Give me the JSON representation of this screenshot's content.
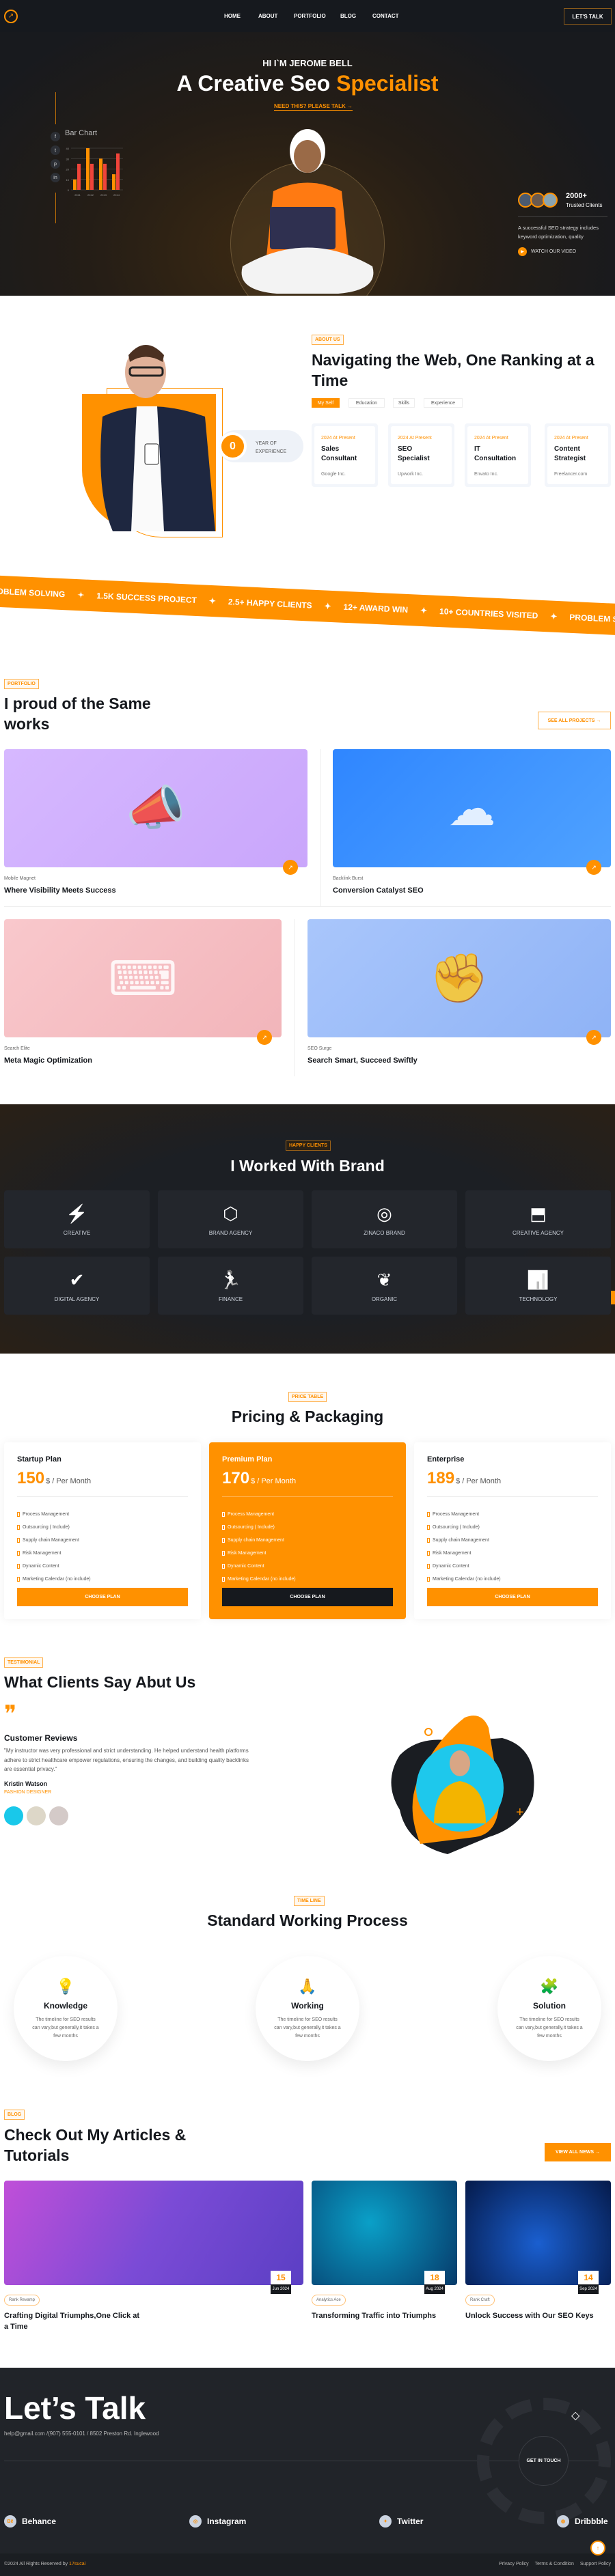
{
  "colors": {
    "accent": "#ff9100",
    "dark": "#16191e",
    "band": "#ff9100"
  },
  "nav": {
    "logo": "chart-logo-icon",
    "links": [
      "HOME",
      "ABOUT",
      "PORTFOLIO",
      "BLOG",
      "CONTACT"
    ],
    "cta": "LET'S TALK"
  },
  "hero": {
    "greeting": "HI I`M JEROME BELL",
    "title_plain": "A Creative Seo",
    "title_accent": "Specialist",
    "cta": "NEED THIS? PLEASE TALK",
    "socials": [
      "facebook-icon",
      "twitter-icon",
      "pinterest-icon",
      "linkedin-icon"
    ],
    "clients_count": "2000+",
    "clients_label": "Trusted Clients",
    "blurb_line1": "A successful SEO strategy includes",
    "blurb_line2": "keyword optimization, quality",
    "video_label": "WATCH OUR VIDEO"
  },
  "chart_data": {
    "type": "bar",
    "title": "Bar Chart",
    "categories": [
      "2011",
      "2012",
      "2013",
      "2014"
    ],
    "series": [
      {
        "color": "#ff9100",
        "values": [
          10,
          40,
          30,
          15
        ]
      },
      {
        "color": "#f0443a",
        "values": [
          25,
          25,
          25,
          35
        ]
      }
    ],
    "ylim": [
      0,
      40
    ],
    "yticks": [
      0,
      10,
      20,
      30,
      40
    ],
    "grid": true
  },
  "about": {
    "tag": "ABOUT US",
    "title_line1": "Navigating the Web, One Ranking at a",
    "title_line2": "Time",
    "exp_number": "0",
    "exp_label_1": "YEAR OF",
    "exp_label_2": "EXPERIENCE",
    "tabs": [
      {
        "label": "My Self",
        "active": true
      },
      {
        "label": "Education"
      },
      {
        "label": "Skills"
      },
      {
        "label": "Experience"
      }
    ],
    "cards": [
      {
        "date": "2024 At Present",
        "title": "Sales Consultant",
        "company": "Google Inc."
      },
      {
        "date": "2024 At Present",
        "title": "SEO Specialist",
        "company": "Upwork Inc."
      },
      {
        "date": "2024 At Present",
        "title": "IT Consultation",
        "company": "Envato Inc."
      },
      {
        "date": "2024 At Present",
        "title": "Content Strategist",
        "company": "Freelancer.com"
      }
    ]
  },
  "band": [
    "PROBLEM SOLVING",
    "1.5K SUCCESS PROJECT",
    "2.5+ HAPPY CLIENTS",
    "12+ AWARD WIN",
    "10+ COUNTRIES VISITED",
    "PROBLEM SOLVING"
  ],
  "portfolio": {
    "tag": "PORTFOLIO",
    "title_line1": "I proud of the Same",
    "title_line2": "works",
    "see_all": "SEE ALL PROJECTS",
    "items": [
      {
        "category": "Mobile Magnet",
        "title": "Where Visibility Meets Success"
      },
      {
        "category": "Backlink Burst",
        "title": "Conversion Catalyst SEO"
      },
      {
        "category": "Search Elite",
        "title": "Meta Magic Optimization"
      },
      {
        "category": "SEO Surge",
        "title": "Search Smart, Succeed Swiftly"
      }
    ]
  },
  "brands": {
    "tag": "HAPPY CLIENTS",
    "title": "I Worked With Brand",
    "items": [
      "CREATIVE",
      "BRAND AGENCY",
      "ZINACO BRAND",
      "CREATIVE AGENCY",
      "DIGITAL AGENCY",
      "FINANCE",
      "ORGANIC",
      "TECHNOLOGY"
    ]
  },
  "pricing": {
    "tag": "PRICE TABLE",
    "title": "Pricing & Packaging",
    "period": "$ / Per Month",
    "button": "CHOOSE PLAN",
    "plans": [
      {
        "name": "Startup Plan",
        "price": "150",
        "highlight": false
      },
      {
        "name": "Premium Plan",
        "price": "170",
        "highlight": true
      },
      {
        "name": "Enterprise",
        "price": "189",
        "highlight": false
      }
    ],
    "features": [
      "Process Management",
      "Outsourcing ( Include)",
      "Supply chain Management",
      "Risk Management",
      "Dynamic Content",
      "Marketing Calendar (no include)"
    ]
  },
  "testimonial": {
    "tag": "TESTIMONIAL",
    "title": "What Clients Say Abut Us",
    "heading": "Customer Reviews",
    "quote_line1": "\"My instructor was very professional and strict understanding. He helped understand health platforms",
    "quote_line2": "adhere to strict healthcare empower regulations, ensuring the changes, and building quality backlinks",
    "quote_line3": "are essential privacy.\"",
    "name": "Kristin Watson",
    "role": "FASHION DESIGNER"
  },
  "process": {
    "tag": "TIME LINE",
    "title": "Standard Working Process",
    "steps": [
      {
        "title": "Knowledge",
        "icon": "lightbulb-icon",
        "text": "The timeline for SEO results can vary,but generally,it takes a few months"
      },
      {
        "title": "Working",
        "icon": "hands-icon",
        "text": "The timeline for SEO results can vary,but generally,it takes a few months"
      },
      {
        "title": "Solution",
        "icon": "puzzle-gear-icon",
        "text": "The timeline for SEO results can vary,but generally,it takes a few months"
      }
    ]
  },
  "blog": {
    "tag": "BLOG",
    "title_line1": "Check Out My Articles &",
    "title_line2": "Tutorials",
    "view_all": "VIEW ALL NEWS",
    "posts": [
      {
        "day": "15",
        "month": "Jun 2024",
        "category": "Rank Revamp",
        "title": "Crafting Digital Triumphs,One Click at a Time"
      },
      {
        "day": "18",
        "month": "Aug 2024",
        "category": "Analytics Ace",
        "title": "Transforming Traffic into Triumphs"
      },
      {
        "day": "14",
        "month": "Sep 2024",
        "category": "Rank Craft",
        "title": "Unlock Success with Our SEO Keys"
      }
    ]
  },
  "footer": {
    "title": "Let’s Talk",
    "contact": "help@gmail.com /(907) 555-0101 / 8502 Preston Rd. Inglewood",
    "get_in_touch": "GET IN TOUCH",
    "socials": [
      {
        "label": "Behance",
        "icon": "behance-icon",
        "glyph": "Bē"
      },
      {
        "label": "Instagram",
        "icon": "instagram-icon",
        "glyph": "◎"
      },
      {
        "label": "Twitter",
        "icon": "twitter-icon",
        "glyph": "✦"
      },
      {
        "label": "Dribbble",
        "icon": "dribbble-icon",
        "glyph": "◍"
      }
    ],
    "copyright": "©2024 All Rights Reserved by ",
    "copyright_brand": "17sucai",
    "links": [
      "Privacy Policy",
      "Terms & Condition",
      "Support Policy"
    ]
  }
}
